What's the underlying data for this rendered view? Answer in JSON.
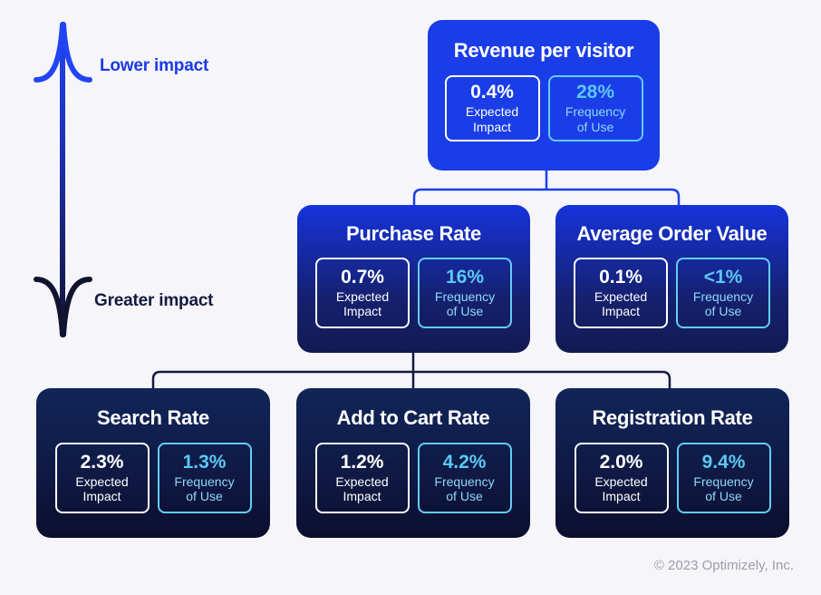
{
  "background_color": "#f6f6fa",
  "axis": {
    "name": "impact-axis",
    "top_label": "Lower impact",
    "bottom_label": "Greater impact",
    "top_color": "#1c39e8",
    "bottom_color": "#151a3f"
  },
  "stat_labels": {
    "expected_impact": "Expected\nImpact",
    "expected_impact_line1": "Expected",
    "expected_impact_line2": "Impact",
    "frequency_of_use_line1": "Frequency",
    "frequency_of_use_line2": "of Use"
  },
  "cards": {
    "revenue": {
      "title": "Revenue per visitor",
      "expected_impact": "0.4%",
      "frequency_of_use": "28%",
      "background_color": "#1a3de8"
    },
    "purchase": {
      "title": "Purchase Rate",
      "expected_impact": "0.7%",
      "frequency_of_use": "16%"
    },
    "aov": {
      "title": "Average Order Value",
      "expected_impact": "0.1%",
      "frequency_of_use": "<1%"
    },
    "search": {
      "title": "Search Rate",
      "expected_impact": "2.3%",
      "frequency_of_use": "1.3%"
    },
    "cart": {
      "title": "Add to Cart Rate",
      "expected_impact": "1.2%",
      "frequency_of_use": "4.2%"
    },
    "registration": {
      "title": "Registration Rate",
      "expected_impact": "2.0%",
      "frequency_of_use": "9.4%"
    }
  },
  "connectors": {
    "upper_color": "#1a3de8",
    "lower_color": "#151a3f"
  },
  "footer": {
    "copyright": "© 2023 Optimizely, Inc."
  }
}
